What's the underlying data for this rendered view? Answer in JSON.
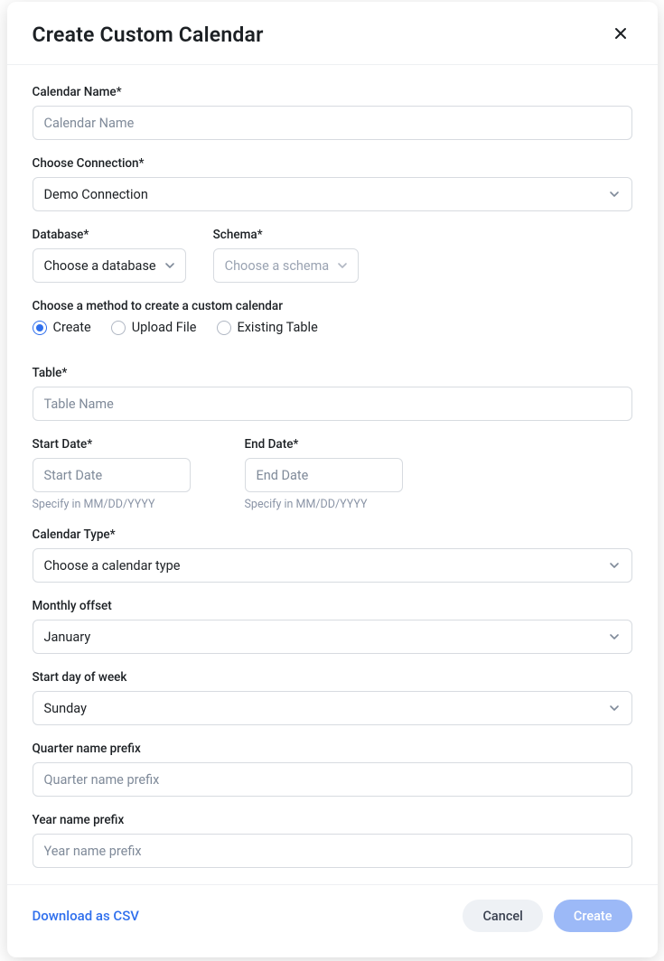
{
  "modal": {
    "title": "Create Custom Calendar"
  },
  "calendarName": {
    "label": "Calendar Name*",
    "placeholder": "Calendar Name"
  },
  "connection": {
    "label": "Choose Connection*",
    "value": "Demo Connection"
  },
  "database": {
    "label": "Database*",
    "placeholder": "Choose a database"
  },
  "schema": {
    "label": "Schema*",
    "placeholder": "Choose a schema"
  },
  "method": {
    "label": "Choose a method to create a custom calendar",
    "options": {
      "create": "Create",
      "upload": "Upload File",
      "existing": "Existing Table"
    },
    "selected": "create"
  },
  "table": {
    "label": "Table*",
    "placeholder": "Table Name"
  },
  "startDate": {
    "label": "Start Date*",
    "placeholder": "Start Date",
    "helper": "Specify in MM/DD/YYYY"
  },
  "endDate": {
    "label": "End Date*",
    "placeholder": "End Date",
    "helper": "Specify in MM/DD/YYYY"
  },
  "calendarType": {
    "label": "Calendar Type*",
    "placeholder": "Choose a calendar type"
  },
  "monthlyOffset": {
    "label": "Monthly offset",
    "value": "January"
  },
  "startDay": {
    "label": "Start day of week",
    "value": "Sunday"
  },
  "quarterPrefix": {
    "label": "Quarter name prefix",
    "placeholder": "Quarter name prefix"
  },
  "yearPrefix": {
    "label": "Year name prefix",
    "placeholder": "Year name prefix"
  },
  "footer": {
    "download": "Download as CSV",
    "cancel": "Cancel",
    "create": "Create"
  }
}
